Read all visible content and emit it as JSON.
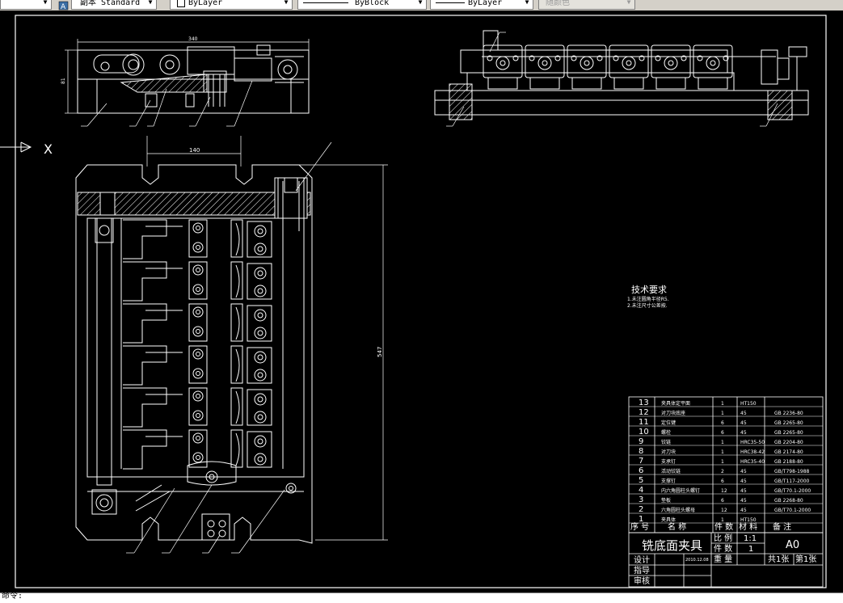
{
  "toolbar": {
    "textstyle": "副本 Standard",
    "layer": "ByLayer",
    "linetype": "ByBlock",
    "lineweight": "ByLayer",
    "plotstyle": "随颜色"
  },
  "drawing": {
    "top_view_dims": {
      "width": "340",
      "height": "81"
    },
    "main_view_dims": {
      "slot_spacing": "140",
      "overall_height": "547"
    },
    "ucs_x_label": "X",
    "tech_req": {
      "title": "技术要求",
      "line1": "1.未注圆角半径R5.",
      "line2": "2.未注尺寸公差按."
    }
  },
  "bom": {
    "rows": [
      {
        "no": "13",
        "name": "夹具体定平面",
        "qty": "1",
        "mat": "HT150",
        "std": ""
      },
      {
        "no": "12",
        "name": "对刀块底座",
        "qty": "1",
        "mat": "45",
        "std": "GB 2236-80"
      },
      {
        "no": "11",
        "name": "定位键",
        "qty": "6",
        "mat": "45",
        "std": "GB 2265-80"
      },
      {
        "no": "10",
        "name": "螺栓",
        "qty": "6",
        "mat": "45",
        "std": "GB 2265-80"
      },
      {
        "no": "9",
        "name": "铰链",
        "qty": "1",
        "mat": "HRC35-50",
        "std": "GB 2204-80"
      },
      {
        "no": "8",
        "name": "对刀块",
        "qty": "1",
        "mat": "HRC38-42",
        "std": "GB 2174-80"
      },
      {
        "no": "7",
        "name": "支承钉",
        "qty": "1",
        "mat": "HRC35-40",
        "std": "GB 2188-80"
      },
      {
        "no": "6",
        "name": "活动铰链",
        "qty": "2",
        "mat": "45",
        "std": "GB/T798-1988"
      },
      {
        "no": "5",
        "name": "支撑钉",
        "qty": "6",
        "mat": "45",
        "std": "GB/T117-2000"
      },
      {
        "no": "4",
        "name": "内六角圆柱头螺钉",
        "qty": "12",
        "mat": "45",
        "std": "GB/T70.1-2000"
      },
      {
        "no": "3",
        "name": "垫板",
        "qty": "6",
        "mat": "45",
        "std": "GB 2268-80"
      },
      {
        "no": "2",
        "name": "六角圆柱头螺母",
        "qty": "12",
        "mat": "45",
        "std": "GB/T70.1-2000"
      },
      {
        "no": "1",
        "name": "夹具体",
        "qty": "1",
        "mat": "HT150",
        "std": ""
      }
    ],
    "header": {
      "no": "序 号",
      "name": "名  称",
      "qty": "件 数",
      "mat": "材 料",
      "note": "备  注"
    }
  },
  "title_block": {
    "title": "铣底面夹具",
    "scale_label": "比 例",
    "scale_value": "1:1",
    "count_label": "件 数",
    "count_value": "1",
    "weight_label": "重 量",
    "sheet_size": "A0",
    "designer_label": "设计",
    "date": "2010.12.08",
    "checker_label": "指导",
    "approver_label": "审核",
    "total_sheets": "共1张",
    "sheet_no": "第1张"
  },
  "command_line": "命令:"
}
